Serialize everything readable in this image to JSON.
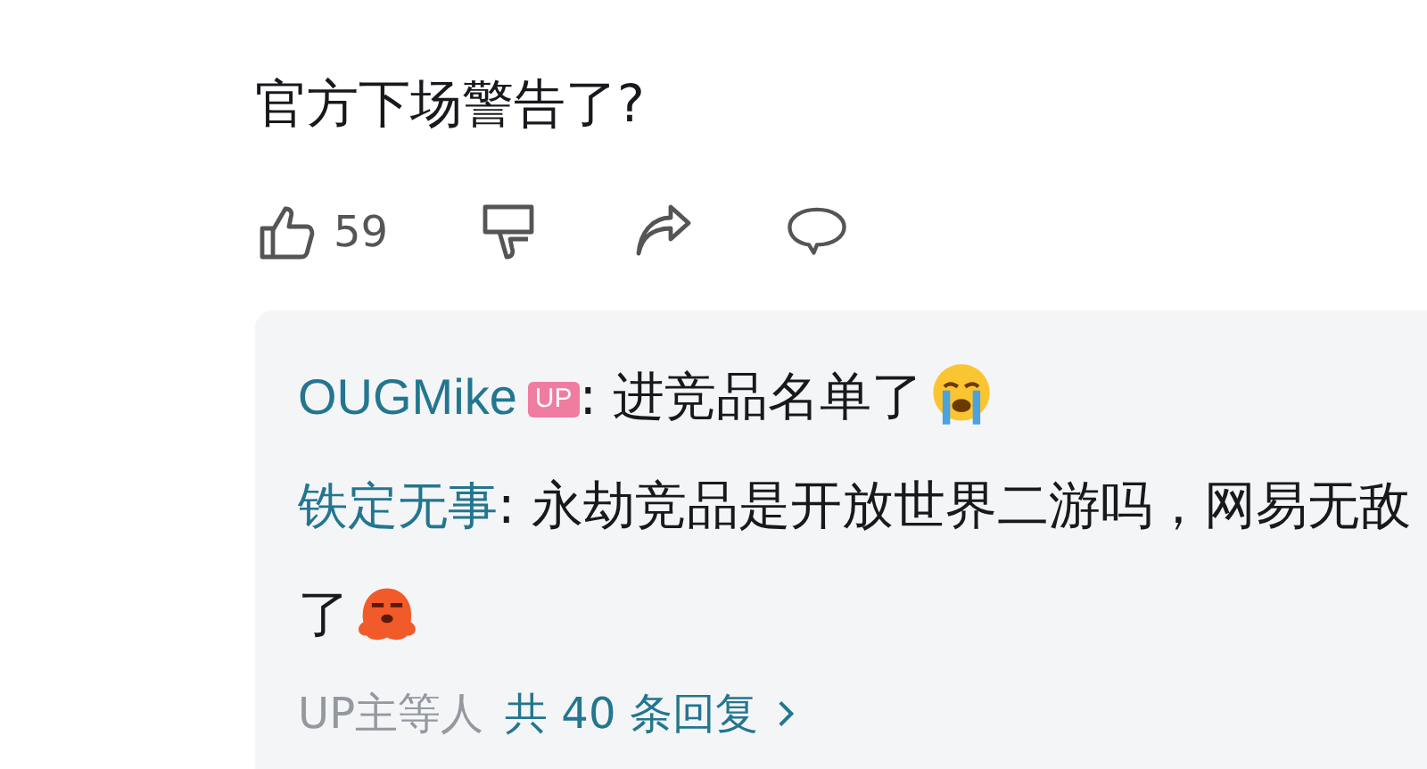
{
  "comment": {
    "text": "官方下场警告了?",
    "likes": "59"
  },
  "replies": [
    {
      "author": "OUGMike",
      "badge": "UP",
      "separator": ":",
      "text": "进竞品名单了",
      "kind": "crying"
    },
    {
      "author": "铁定无事",
      "separator": ":",
      "text": "永劫竞品是开放世界二游吗，网易无敌了",
      "kind": "blob"
    }
  ],
  "summary": {
    "names": "UP主等人",
    "link": "共 40 条回复"
  }
}
